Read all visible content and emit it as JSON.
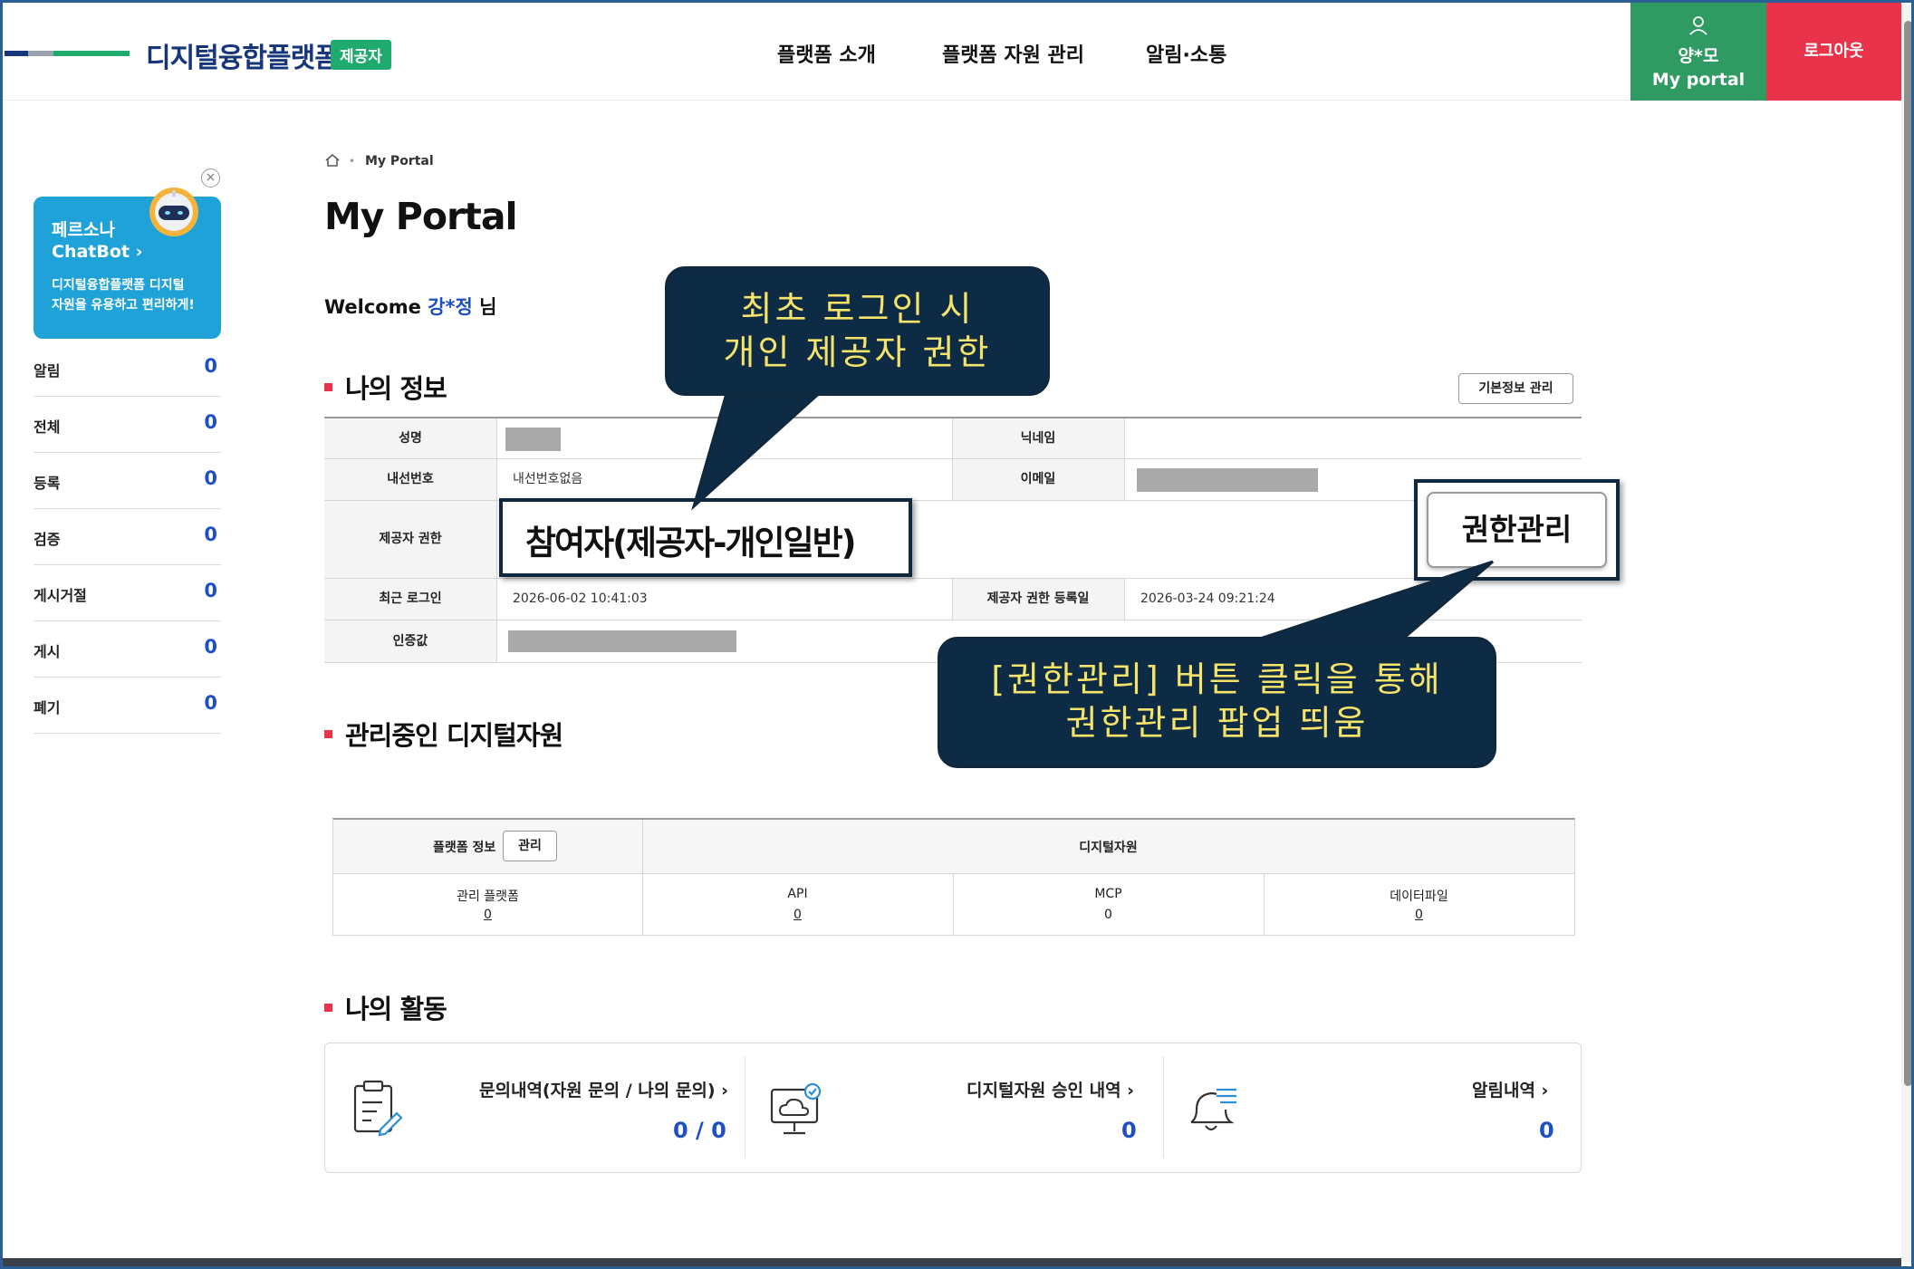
{
  "header": {
    "logo_text": "디지털융합플랫폼",
    "badge": "제공자",
    "nav": [
      "플랫폼 소개",
      "플랫폼 자원 관리",
      "알림·소통"
    ],
    "user_name": "양*모",
    "user_portal": "My portal",
    "logout": "로그아웃"
  },
  "sidebar": {
    "chatbot": {
      "title1": "페르소나",
      "title2": "ChatBot  ›",
      "desc1": "디지털융합플랫폼 디지털",
      "desc2": "자원을 유용하고 편리하게!",
      "close": "×"
    },
    "items": [
      {
        "label": "알림",
        "count": "0"
      },
      {
        "label": "전체",
        "count": "0"
      },
      {
        "label": "등록",
        "count": "0"
      },
      {
        "label": "검증",
        "count": "0"
      },
      {
        "label": "게시거절",
        "count": "0"
      },
      {
        "label": "게시",
        "count": "0"
      },
      {
        "label": "폐기",
        "count": "0"
      }
    ]
  },
  "breadcrumb": {
    "dot": "•",
    "label": "My Portal"
  },
  "page_title": "My Portal",
  "welcome": {
    "prefix": "Welcome ",
    "name": "강*정",
    "suffix": " 님"
  },
  "my_info": {
    "title": "나의 정보",
    "basic_info_button": "기본정보 관리",
    "rows": {
      "name_label": "성명",
      "nickname_label": "닉네임",
      "ext_label": "내선번호",
      "ext_value": "내선번호없음",
      "email_label": "이메일",
      "role_label": "제공자 권한",
      "role_value": "참여자(제공자-개인일반)",
      "role_button": "권한관리",
      "last_login_label": "최근 로그인",
      "last_login_value": "2026-06-02 10:41:03",
      "role_date_label": "제공자 권한 등록일",
      "role_date_value": "2026-03-24 09:21:24",
      "auth_label": "인증값"
    }
  },
  "callouts": {
    "first_line1": "최초 로그인 시",
    "first_line2": "개인 제공자 권한",
    "second_line1": "[권한관리] 버튼 클릭을 통해",
    "second_line2": "권한관리 팝업 띄움"
  },
  "resources": {
    "title": "관리중인 디지털자원",
    "platform_info": "플랫폼 정보",
    "manage_button": "관리",
    "digital_resources": "디지털자원",
    "columns": [
      {
        "label": "관리 플랫폼",
        "value": "0"
      },
      {
        "label": "API",
        "value": "0"
      },
      {
        "label": "MCP",
        "value": "0"
      },
      {
        "label": "데이터파일",
        "value": "0"
      }
    ]
  },
  "activity": {
    "title": "나의 활동",
    "items": [
      {
        "label": "문의내역(자원 문의 / 나의 문의)  ›",
        "count": "0 / 0"
      },
      {
        "label": "디지털자원 승인 내역  ›",
        "count": "0"
      },
      {
        "label": "알림내역  ›",
        "count": "0"
      }
    ]
  },
  "colors": {
    "navy": "#16357a",
    "green": "#2f9a62",
    "red": "#e8334a",
    "blue": "#1f4fc4",
    "callout_bg": "#0d2b44",
    "callout_text": "#f6e36a"
  }
}
